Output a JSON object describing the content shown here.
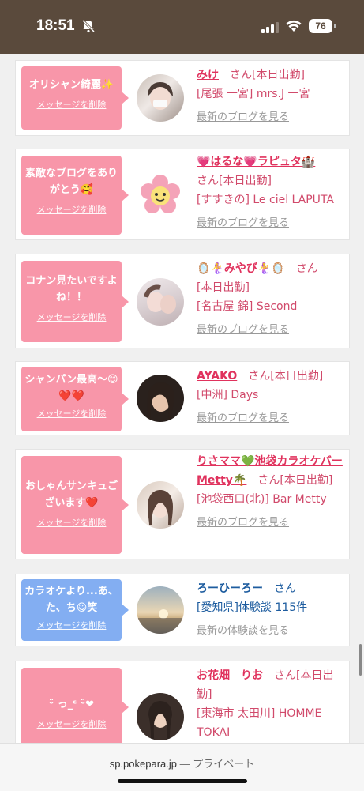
{
  "status": {
    "time": "18:51",
    "battery": "76"
  },
  "browser": {
    "domain": "sp.pokepara.jp",
    "separator": "—",
    "mode": "プライベート"
  },
  "colors": {
    "pink_bubble": "#f896a9",
    "blue_bubble": "#83aef2",
    "name_pink": "#e0325d",
    "name_blue": "#1d5c9f",
    "status_bar": "#5a4a3c"
  },
  "common": {
    "delete_label": "メッセージを削除",
    "blog_link": "最新のブログを見る",
    "review_link": "最新の体験談を見る",
    "san": "さん",
    "today": "[本日出勤]"
  },
  "messages": [
    {
      "bubble": "オリシャン綺麗✨",
      "name": "みけ",
      "suffix": "さん[本日出勤]",
      "shop": "[尾張 一宮] mrs.J 一宮",
      "link": "最新のブログを見る"
    },
    {
      "bubble": "素敵なブログをありがとう🥰",
      "name": "💗はるな💗ラピュタ🏰",
      "suffix": "さん[本日出勤]",
      "shop": "[すすきの] Le ciel LAPUTA",
      "link": "最新のブログを見る"
    },
    {
      "bubble": "コナン見たいですよね！！",
      "name": "🪞🧜‍♀️みやび🧜‍♀️🪞",
      "suffix": "さん",
      "today": "[本日出勤]",
      "shop": "[名古屋 錦] Second",
      "link": "最新のブログを見る"
    },
    {
      "bubble": "シャンパン最高〜😊❤️❤️",
      "name": "AYAKO",
      "suffix": "さん[本日出勤]",
      "shop": "[中洲] Days",
      "link": "最新のブログを見る"
    },
    {
      "bubble": "おしゃんサンキュございます❤️",
      "name": "りさママ💚池袋カラオケバーMetty🌴",
      "suffix": "さん[本日出勤]",
      "shop": "[池袋西口(北)] Bar Metty",
      "link": "最新のブログを見る"
    },
    {
      "bubble": "カラオケより...あ、た、ち😋笑",
      "name": "ろーひーろー",
      "suffix": "さん",
      "shop": "[愛知県]体験談 115件",
      "link": "最新の体験談を見る"
    },
    {
      "bubble": "ᵕ̈ っ_ᵋ ᵕ̈❤︎",
      "name": "お花畑　りお",
      "suffix": "さん[本日出勤]",
      "shop": "[東海市 太田川] HOMME TOKAI",
      "link": ""
    }
  ]
}
